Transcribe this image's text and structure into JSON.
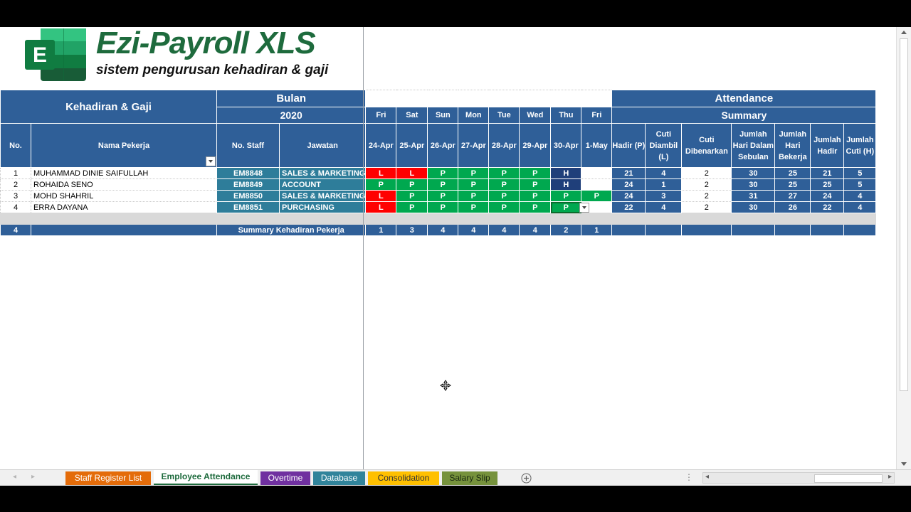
{
  "brand": {
    "title": "Ezi-Payroll XLS",
    "subtitle": "sistem pengurusan kehadiran & gaji",
    "icon_letter": "E"
  },
  "header": {
    "kehadiran_label": "Kehadiran & Gaji",
    "bulan_label": "Bulan",
    "year": "2020",
    "attendance_label": "Attendance",
    "summary_label": "Summary",
    "col_no": "No.",
    "col_nama": "Nama Pekerja",
    "col_staff": "No. Staff",
    "col_jawatan": "Jawatan",
    "days": [
      "Fri",
      "Sat",
      "Sun",
      "Mon",
      "Tue",
      "Wed",
      "Thu",
      "Fri"
    ],
    "dates": [
      "24-Apr",
      "25-Apr",
      "26-Apr",
      "27-Apr",
      "28-Apr",
      "29-Apr",
      "30-Apr",
      "1-May"
    ],
    "summary_cols": [
      "Hadir (P)",
      "Cuti Diambil (L)",
      "Cuti Dibenarkan",
      "Jumlah Hari Dalam Sebulan",
      "Jumlah Hari Bekerja",
      "Jumlah Hadir",
      "Jumlah Cuti (H)"
    ]
  },
  "employees": [
    {
      "no": "1",
      "nama": "MUHAMMAD DINIE SAIFULLAH",
      "staff": "EM8848",
      "jawatan": "SALES & MARKETING",
      "att": [
        "L",
        "L",
        "P",
        "P",
        "P",
        "P",
        "H",
        ""
      ],
      "summary": [
        "21",
        "4",
        "2",
        "30",
        "25",
        "21",
        "5"
      ]
    },
    {
      "no": "2",
      "nama": "ROHAIDA SENO",
      "staff": "EM8849",
      "jawatan": "ACCOUNT",
      "att": [
        "P",
        "P",
        "P",
        "P",
        "P",
        "P",
        "H",
        ""
      ],
      "summary": [
        "24",
        "1",
        "2",
        "30",
        "25",
        "25",
        "5"
      ]
    },
    {
      "no": "3",
      "nama": "MOHD SHAHRIL",
      "staff": "EM8850",
      "jawatan": "SALES & MARKETING",
      "att": [
        "L",
        "P",
        "P",
        "P",
        "P",
        "P",
        "P",
        "P"
      ],
      "summary": [
        "24",
        "3",
        "2",
        "31",
        "27",
        "24",
        "4"
      ]
    },
    {
      "no": "4",
      "nama": "ERRA DAYANA",
      "staff": "EM8851",
      "jawatan": "PURCHASING",
      "att": [
        "L",
        "P",
        "P",
        "P",
        "P",
        "P",
        "P",
        ""
      ],
      "summary": [
        "22",
        "4",
        "2",
        "30",
        "26",
        "22",
        "4"
      ]
    }
  ],
  "summary_row": {
    "count": "4",
    "label": "Summary Kehadiran Pekerja",
    "totals": [
      "1",
      "3",
      "4",
      "4",
      "4",
      "4",
      "2",
      "1"
    ]
  },
  "tabs": [
    {
      "label": "Staff Register List",
      "color": "#e46c0a"
    },
    {
      "label": "Employee Attendance",
      "color": "#ffffff"
    },
    {
      "label": "Overtime",
      "color": "#7030a0"
    },
    {
      "label": "Database",
      "color": "#31849b"
    },
    {
      "label": "Consolidation",
      "color": "#ffc000"
    },
    {
      "label": "Salary Slip",
      "color": "#76923c"
    }
  ],
  "colors": {
    "header_blue": "#2f5f98",
    "staff_teal": "#2e7d9a",
    "leave_red": "#ff0000",
    "present_green": "#00a84f",
    "holiday_navy": "#1f3f7a",
    "brand_green": "#1e6b3d"
  },
  "icons": {
    "logo": "excel-logo-icon",
    "cursor": "move-cursor-icon",
    "add_sheet": "plus-circle-icon"
  }
}
